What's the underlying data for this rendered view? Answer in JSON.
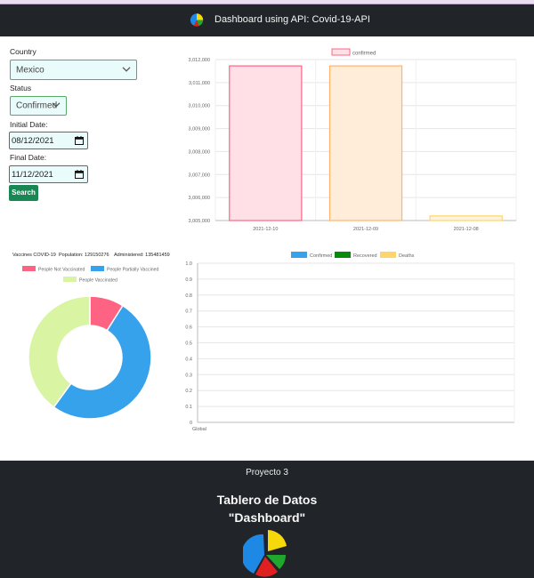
{
  "navbar": {
    "title": "Dashboard using API: Covid-19-API",
    "logo_icon": "pie-chart-logo-icon"
  },
  "form": {
    "country_label": "Country",
    "country_value": "Mexico",
    "status_label": "Status",
    "status_value": "Confirmed",
    "initial_date_label": "Initial Date:",
    "initial_date_value": "08/12/2021",
    "final_date_label": "Final Date:",
    "final_date_value": "11/12/2021",
    "search_label": "Search"
  },
  "colors": {
    "pink": "#ff6384",
    "pink_fill": "#ffe0e6",
    "orange": "#ffb36b",
    "orange_fill": "#ffecd9",
    "yellow": "#ffd46b",
    "yellow_fill": "#fff5dd",
    "blue": "#36a2eb",
    "lime": "#d9f5a3",
    "green": "#0a8a0a"
  },
  "chart_data": [
    {
      "type": "bar",
      "legend": [
        "confirmed"
      ],
      "categories": [
        "2021-12-10",
        "2021-12-09",
        "2021-12-08"
      ],
      "values": [
        3011725,
        3011725,
        3005200
      ],
      "ylim": [
        3005000,
        3012000
      ],
      "yticks": [
        "3,005,000",
        "3,006,000",
        "3,007,000",
        "3,008,000",
        "3,009,000",
        "3,010,000",
        "3,011,000",
        "3,012,000"
      ],
      "grid": true,
      "legend_position": "top"
    },
    {
      "type": "pie",
      "title": "Vaccines COVID-19",
      "population_label": "Population: 129150276",
      "administered_label": "Administered: 135481459",
      "labels": [
        "People Not Vaccinated",
        "People Partially Vaccined",
        "People Vaccinated"
      ],
      "values": [
        9,
        51,
        40
      ],
      "legend_position": "top"
    },
    {
      "type": "bar",
      "legend": [
        "Confirmed",
        "Recovered",
        "Deaths"
      ],
      "categories": [
        "Global"
      ],
      "series": [
        {
          "name": "Confirmed",
          "values": [
            0
          ]
        },
        {
          "name": "Recovered",
          "values": [
            0
          ]
        },
        {
          "name": "Deaths",
          "values": [
            0
          ]
        }
      ],
      "ylim": [
        0,
        1.0
      ],
      "yticks": [
        "0",
        "0.1",
        "0.2",
        "0.3",
        "0.4",
        "0.5",
        "0.6",
        "0.7",
        "0.8",
        "0.9",
        "1.0"
      ],
      "grid": true,
      "legend_position": "top"
    }
  ],
  "footer": {
    "project": "Proyecto 3",
    "title_line1": "Tablero de Datos",
    "title_line2": "\"Dashboard\"",
    "logo_icon": "pie-chart-logo-icon"
  }
}
